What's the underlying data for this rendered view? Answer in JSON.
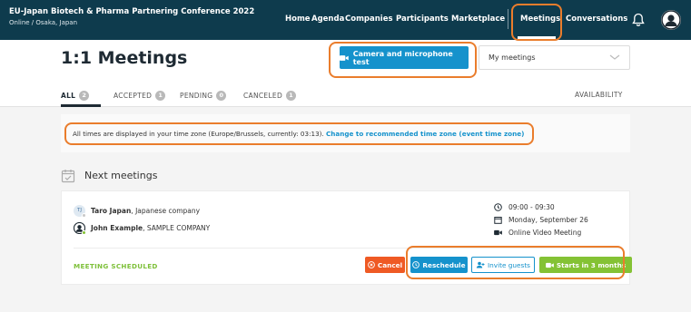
{
  "app": {
    "title": "EU-Japan Biotech & Pharma Partnering Conference 2022",
    "location": "Online / Osaka, Japan"
  },
  "nav": {
    "items": [
      "Home",
      "Agenda",
      "Companies",
      "Participants",
      "Marketplace",
      "Meetings",
      "Conversations"
    ],
    "active": "Meetings",
    "icons": [
      "bell-icon",
      "user-avatar-icon"
    ]
  },
  "page": {
    "title": "1:1 Meetings",
    "camera_button": "Camera and microphone test",
    "filter_select": "My meetings"
  },
  "tabs": [
    {
      "label": "ALL",
      "count": "2",
      "active": true
    },
    {
      "label": "ACCEPTED",
      "count": "1",
      "active": false
    },
    {
      "label": "PENDING",
      "count": "0",
      "active": false
    },
    {
      "label": "CANCELED",
      "count": "1",
      "active": false
    }
  ],
  "availability_label": "AVAILABILITY",
  "timezone_banner": {
    "text": "All times are displayed in your time zone (Europe/Brussels, currently: 03:13).",
    "link": "Change to recommended time zone (event time zone)"
  },
  "next_meetings": {
    "title": "Next meetings",
    "meeting": {
      "participants": [
        {
          "initials": "TJ",
          "name": "Taro Japan",
          "company": ", Japanese company"
        },
        {
          "initials": "",
          "name": "John Example",
          "company": ", SAMPLE COMPANY"
        }
      ],
      "time": "09:00 - 09:30",
      "date": "Monday, September 26",
      "type": "Online Video Meeting",
      "status": "MEETING SCHEDULED",
      "actions": {
        "cancel": "Cancel",
        "reschedule": "Reschedule",
        "invite": "Invite guests",
        "starts": "Starts in 3 months"
      }
    }
  },
  "colors": {
    "nav_bg": "#0e3b4d",
    "primary": "#1592cc",
    "cancel": "#ef5a24",
    "success": "#84c234",
    "highlight": "#ea7d2c"
  }
}
